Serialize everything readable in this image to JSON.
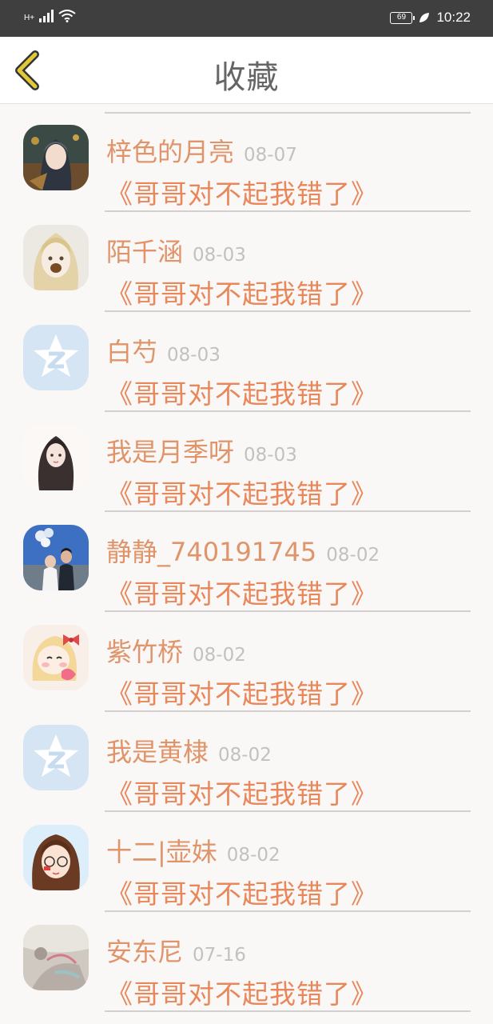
{
  "status_bar": {
    "network": "H+",
    "battery": "69",
    "time": "10:22"
  },
  "header": {
    "title": "收藏"
  },
  "favorites": [
    {
      "name": "梓色的月亮",
      "date": "08-07",
      "title": "《哥哥对不起我错了》",
      "avatar": "anime-girl-dark"
    },
    {
      "name": "陌千涵",
      "date": "08-03",
      "title": "《哥哥对不起我错了》",
      "avatar": "blonde-girl"
    },
    {
      "name": "白芍",
      "date": "08-03",
      "title": "《哥哥对不起我错了》",
      "avatar": "qzone-default"
    },
    {
      "name": "我是月季呀",
      "date": "08-03",
      "title": "《哥哥对不起我错了》",
      "avatar": "long-hair-girl"
    },
    {
      "name": "静静_740191745",
      "date": "08-02",
      "title": "《哥哥对不起我错了》",
      "avatar": "couple-photo"
    },
    {
      "name": "紫竹桥",
      "date": "08-02",
      "title": "《哥哥对不起我错了》",
      "avatar": "bow-girl"
    },
    {
      "name": "我是黄棣",
      "date": "08-02",
      "title": "《哥哥对不起我错了》",
      "avatar": "qzone-default"
    },
    {
      "name": "十二|壶妹",
      "date": "08-02",
      "title": "《哥哥对不起我错了》",
      "avatar": "glasses-girl"
    },
    {
      "name": "安东尼",
      "date": "07-16",
      "title": "《哥哥对不起我错了》",
      "avatar": "blurry-photo"
    }
  ],
  "colors": {
    "name": "#e0946a",
    "title": "#e8875a",
    "date": "#c4c0c0",
    "back_arrow": "#e2c93a"
  }
}
